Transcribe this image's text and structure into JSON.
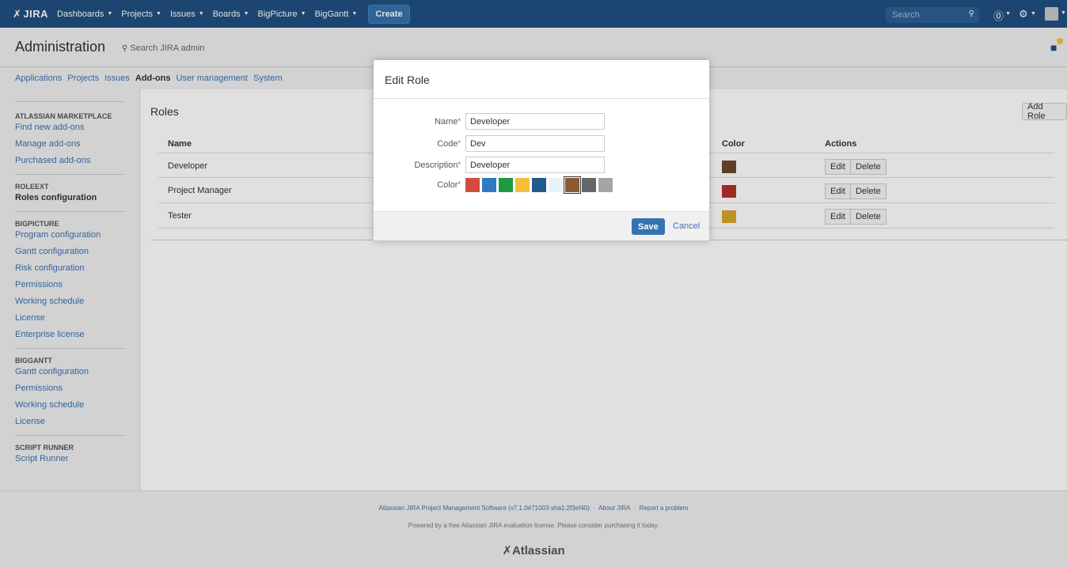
{
  "topnav": {
    "logo": "JIRA",
    "items": [
      "Dashboards",
      "Projects",
      "Issues",
      "Boards",
      "BigPicture",
      "BigGantt"
    ],
    "create": "Create",
    "search_placeholder": "Search"
  },
  "admin": {
    "title": "Administration",
    "search": "Search JIRA admin",
    "tabs": [
      "Applications",
      "Projects",
      "Issues",
      "Add-ons",
      "User management",
      "System"
    ],
    "active_tab": "Add-ons"
  },
  "sidebar": {
    "sections": [
      {
        "title": "ATLASSIAN MARKETPLACE",
        "items": [
          "Find new add-ons",
          "Manage add-ons",
          "Purchased add-ons"
        ]
      },
      {
        "title": "ROLEEXT",
        "items": [
          "Roles configuration"
        ]
      },
      {
        "title": "BIGPICTURE",
        "items": [
          "Program configuration",
          "Gantt configuration",
          "Risk configuration",
          "Permissions",
          "Working schedule",
          "License",
          "Enterprise license"
        ]
      },
      {
        "title": "BIGGANTT",
        "items": [
          "Gantt configuration",
          "Permissions",
          "Working schedule",
          "License"
        ]
      },
      {
        "title": "SCRIPT RUNNER",
        "items": [
          "Script Runner"
        ]
      }
    ],
    "active_item": "Roles configuration"
  },
  "roles": {
    "title": "Roles",
    "add_button": "Add Role",
    "headers": {
      "name": "Name",
      "color": "Color",
      "actions": "Actions"
    },
    "rows": [
      {
        "name": "Developer",
        "color": "#6b4a2b"
      },
      {
        "name": "Project Manager",
        "color": "#b5302a"
      },
      {
        "name": "Tester",
        "color": "#d8a72a"
      }
    ],
    "edit_label": "Edit",
    "delete_label": "Delete"
  },
  "dialog": {
    "title": "Edit Role",
    "fields": {
      "name_label": "Name",
      "name_value": "Developer",
      "code_label": "Code",
      "code_value": "Dev",
      "description_label": "Description",
      "description_value": "Developer",
      "color_label": "Color"
    },
    "required_mark": "*",
    "palette": [
      "#d24b3e",
      "#2f7ac3",
      "#1e9a3f",
      "#f4bf3a",
      "#225a8f",
      "#e9f1fb",
      "#8a5b32",
      "#666666",
      "#a5a5a5"
    ],
    "selected_color": "#8a5b32",
    "save": "Save",
    "cancel": "Cancel"
  },
  "footer": {
    "software": "Atlassian JIRA Project Management Software (v7.1.0#71003-sha1:2f3ef40)",
    "about": "About JIRA",
    "report": "Report a problem",
    "license_note": "Powered by a free Atlassian JIRA evaluation license. Please consider purchasing it today.",
    "logo": "Atlassian"
  }
}
